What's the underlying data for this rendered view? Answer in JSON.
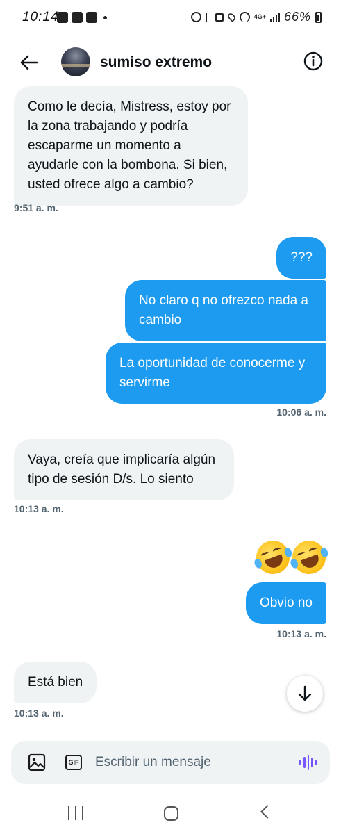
{
  "status_bar": {
    "time": "10:14",
    "network": "4G+",
    "battery": "66%"
  },
  "header": {
    "contact_name": "sumiso extremo"
  },
  "messages": [
    {
      "side": "received",
      "text": "Como le decía, Mistress, estoy por la zona trabajando y podría escaparme un momento a ayudarle con la bombona. Si bien, usted ofrece algo a cambio?"
    },
    {
      "side": "sent",
      "text": "???"
    },
    {
      "side": "sent",
      "text": "No claro q no ofrezco nada a cambio"
    },
    {
      "side": "sent",
      "text": "La oportunidad de conocerme y servirme"
    },
    {
      "side": "received",
      "text": "Vaya, creía que implicaría algún tipo de sesión D/s. Lo siento"
    },
    {
      "side": "sent",
      "text": "Obvio no"
    },
    {
      "side": "received",
      "text": "Está bien"
    }
  ],
  "emoji_message": {
    "emoji": "rolling-on-floor-laughing-face",
    "count": 2
  },
  "timestamps": [
    "9:51 a. m.",
    "10:06 a. m.",
    "10:13 a. m.",
    "10:13 a. m.",
    "10:13 a. m."
  ],
  "composer": {
    "placeholder": "Escribir un mensaje",
    "gif_label": "GIF"
  },
  "colors": {
    "sent_bubble": "#1d9bf0",
    "received_bubble": "#eff3f4",
    "voice_accent": "#7856ff",
    "timestamp": "#536471"
  }
}
